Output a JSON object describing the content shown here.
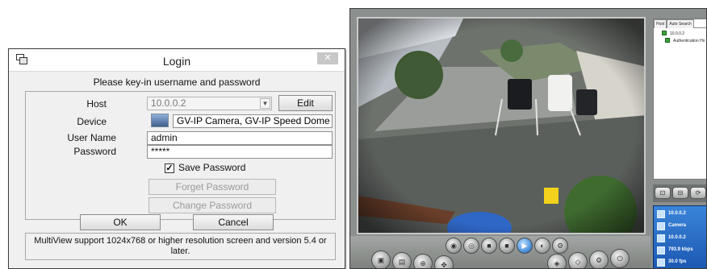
{
  "login": {
    "title": "Login",
    "close_label": "✕",
    "prompt": "Please key-in username and password",
    "host_label": "Host",
    "host_value": "10.0.0.2",
    "edit_label": "Edit",
    "device_label": "Device",
    "device_value": "GV-IP Camera, GV-IP Speed Dome",
    "username_label": "User Name",
    "username_value": "admin",
    "password_label": "Password",
    "password_value": "*****",
    "save_password_label": "Save Password",
    "save_password_checked": true,
    "forget_password_label": "Forget Password",
    "change_password_label": "Change Password",
    "ok_label": "OK",
    "cancel_label": "Cancel",
    "notice": "MultiView support 1024x768 or higher resolution screen and version 5.4 or later."
  },
  "viewer": {
    "tabs": [
      "Host",
      "Auto Search"
    ],
    "tree": [
      {
        "label": "10.0.0.2"
      },
      {
        "label": "Authentication Ho"
      }
    ],
    "status": [
      {
        "icon": "host-icon",
        "text": "10.0.0.2"
      },
      {
        "icon": "camera-icon",
        "text": "Camera"
      },
      {
        "icon": "ip-icon",
        "text": "10.0.0.2"
      },
      {
        "icon": "bitrate-icon",
        "text": "793.9 kbps"
      },
      {
        "icon": "fps-icon",
        "text": "30.0 fps"
      }
    ]
  },
  "colors": {
    "dialog_bg": "#f0f0f0",
    "status_panel": "#2a6ec9",
    "viewer_frame": "#8b8f8d"
  }
}
